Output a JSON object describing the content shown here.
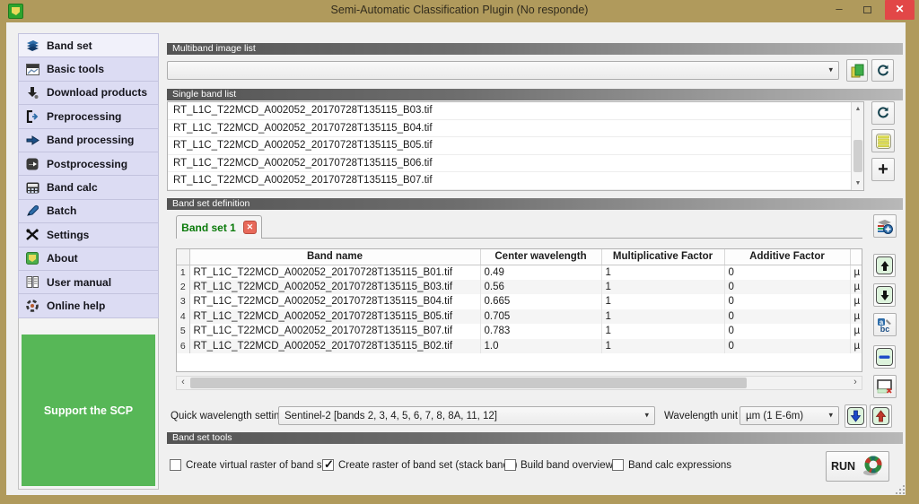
{
  "window": {
    "title": "Semi-Automatic Classification Plugin (No responde)",
    "minimize_glyph": "–",
    "close_glyph": "✕"
  },
  "sidebar": {
    "items": [
      {
        "label": "Band set",
        "icon": "layers-icon",
        "selected": true
      },
      {
        "label": "Basic tools",
        "icon": "image-chart-icon",
        "selected": false
      },
      {
        "label": "Download products",
        "icon": "download-icon",
        "selected": false
      },
      {
        "label": "Preprocessing",
        "icon": "bracket-arrow-icon",
        "selected": false
      },
      {
        "label": "Band processing",
        "icon": "arrow-right-icon",
        "selected": false
      },
      {
        "label": "Postprocessing",
        "icon": "arrow-box-icon",
        "selected": false
      },
      {
        "label": "Band calc",
        "icon": "calculator-icon",
        "selected": false
      },
      {
        "label": "Batch",
        "icon": "pen-icon",
        "selected": false
      },
      {
        "label": "Settings",
        "icon": "tools-icon",
        "selected": false
      },
      {
        "label": "About",
        "icon": "scp-logo-icon",
        "selected": false
      },
      {
        "label": "User manual",
        "icon": "manual-icon",
        "selected": false
      },
      {
        "label": "Online help",
        "icon": "help-gear-icon",
        "selected": false
      }
    ],
    "support_label": "Support the SCP"
  },
  "sections": {
    "multiband": "Multiband image list",
    "single_band": "Single band list",
    "band_set_definition": "Band set definition",
    "band_set_tools": "Band set tools"
  },
  "multiband": {
    "combo_value": "",
    "combo_arrow": "▾"
  },
  "single_band_list": {
    "files": [
      "RT_L1C_T22MCD_A002052_20170728T135115_B03.tif",
      "RT_L1C_T22MCD_A002052_20170728T135115_B04.tif",
      "RT_L1C_T22MCD_A002052_20170728T135115_B05.tif",
      "RT_L1C_T22MCD_A002052_20170728T135115_B06.tif",
      "RT_L1C_T22MCD_A002052_20170728T135115_B07.tif"
    ],
    "scroll_up_glyph": "▲",
    "scroll_down_glyph": "▼"
  },
  "band_set": {
    "tab_label": "Band set 1",
    "tab_close_glyph": "✕",
    "table": {
      "headers": [
        "Band name",
        "Center wavelength",
        "Multiplicative Factor",
        "Additive Factor"
      ],
      "unit_suffix": "µ",
      "rows": [
        {
          "num": "1",
          "name": "RT_L1C_T22MCD_A002052_20170728T135115_B01.tif",
          "wavelength": "0.49",
          "mult": "1",
          "add": "0"
        },
        {
          "num": "2",
          "name": "RT_L1C_T22MCD_A002052_20170728T135115_B03.tif",
          "wavelength": "0.56",
          "mult": "1",
          "add": "0"
        },
        {
          "num": "3",
          "name": "RT_L1C_T22MCD_A002052_20170728T135115_B04.tif",
          "wavelength": "0.665",
          "mult": "1",
          "add": "0"
        },
        {
          "num": "4",
          "name": "RT_L1C_T22MCD_A002052_20170728T135115_B05.tif",
          "wavelength": "0.705",
          "mult": "1",
          "add": "0"
        },
        {
          "num": "5",
          "name": "RT_L1C_T22MCD_A002052_20170728T135115_B07.tif",
          "wavelength": "0.783",
          "mult": "1",
          "add": "0"
        },
        {
          "num": "6",
          "name": "RT_L1C_T22MCD_A002052_20170728T135115_B02.tif",
          "wavelength": "1.0",
          "mult": "1",
          "add": "0"
        }
      ]
    },
    "hscroll_left_glyph": "‹",
    "hscroll_right_glyph": "›"
  },
  "quick_wavelength": {
    "label": "Quick wavelength settings",
    "value": "Sentinel-2 [bands 2, 3, 4, 5, 6, 7, 8, 8A, 11, 12]",
    "unit_label": "Wavelength unit",
    "unit_value": "µm (1 E-6m)"
  },
  "tools": {
    "checkboxes": [
      {
        "label": "Create virtual raster of band set",
        "checked": false
      },
      {
        "label": "Create raster of band set (stack bands)",
        "checked": true
      },
      {
        "label": "Build band overviews",
        "checked": false
      },
      {
        "label": "Band calc expressions",
        "checked": false
      }
    ],
    "run_label": "RUN"
  },
  "icons": {
    "plus_glyph": "+",
    "sort_abc_text": "bc",
    "sort_abc_top": "a"
  },
  "colors": {
    "titlebar": "#b09a5c",
    "close_button": "#e24747",
    "sidebar_item": "#dcdcf3",
    "sidebar_selected": "#f1f1fa",
    "support_green": "#57b757",
    "header_dark": "#545454",
    "header_light": "#b8b8b8",
    "tab_text_green": "#0a7a0a",
    "pale_green_button": "#ddf3dc"
  }
}
